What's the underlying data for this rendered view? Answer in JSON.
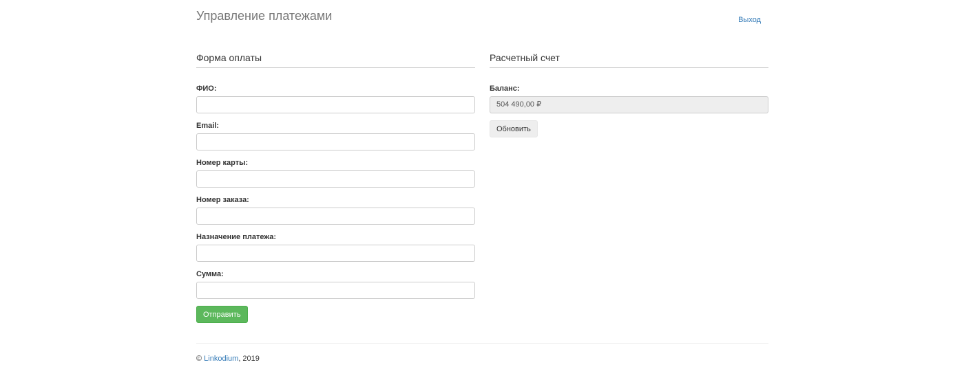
{
  "header": {
    "title": "Управление платежами",
    "logout_label": "Выход"
  },
  "payment_form": {
    "title": "Форма оплаты",
    "fields": [
      {
        "label": "ФИО:",
        "value": "",
        "placeholder": ""
      },
      {
        "label": "Email:",
        "value": "",
        "placeholder": ""
      },
      {
        "label": "Номер карты:",
        "value": "",
        "placeholder": ""
      },
      {
        "label": "Номер заказа:",
        "value": "",
        "placeholder": ""
      },
      {
        "label": "Назначение платежа:",
        "value": "",
        "placeholder": ""
      },
      {
        "label": "Сумма:",
        "value": "",
        "placeholder": ""
      }
    ],
    "submit_label": "Отправить"
  },
  "account": {
    "title": "Расчетный счет",
    "balance_label": "Баланс:",
    "balance_value": "504 490,00 ₽",
    "refresh_label": "Обновить"
  },
  "footer": {
    "copyright_symbol": "©",
    "company_link": "Linkodium",
    "year_text": ", 2019"
  },
  "colors": {
    "link": "#337ab7",
    "success": "#5cb85c",
    "readonly_bg": "#eeeeee"
  }
}
